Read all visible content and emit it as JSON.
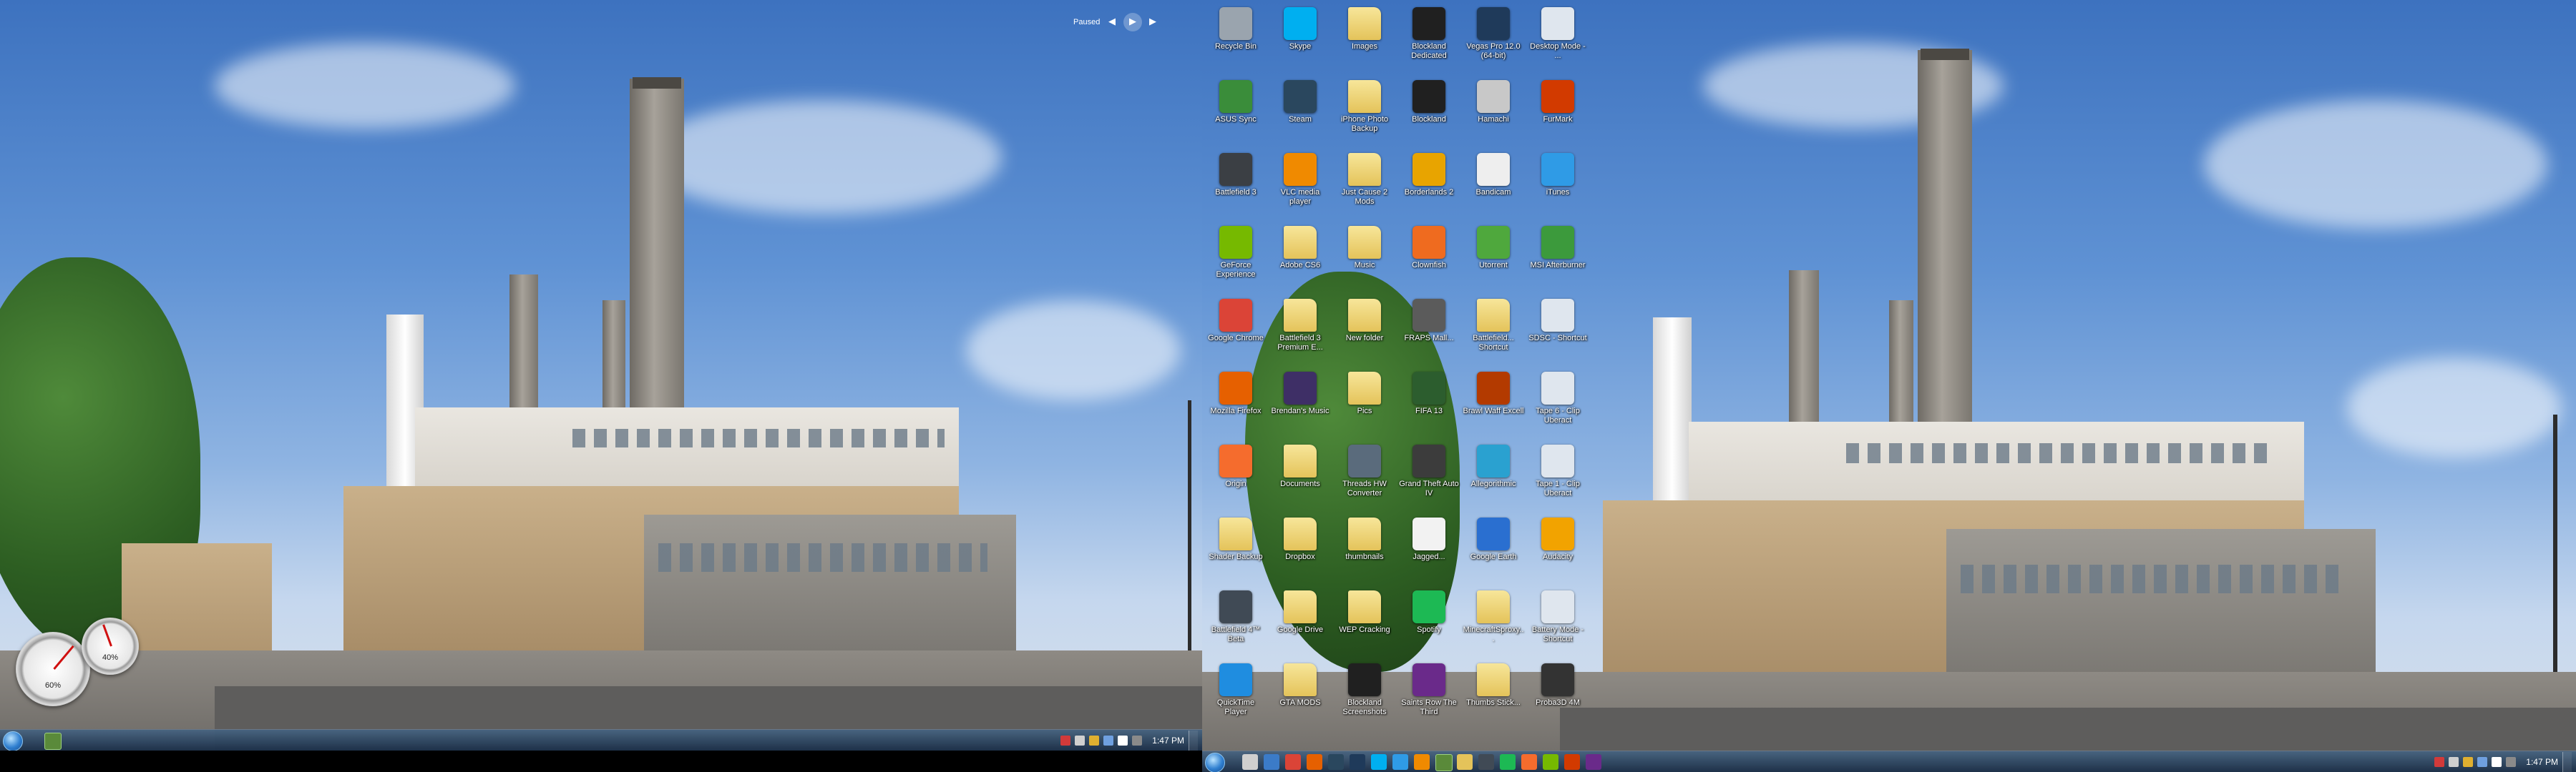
{
  "left_monitor": {
    "taskbar": {
      "clock": "1:47 PM"
    },
    "media_gadget": {
      "label": "Paused"
    },
    "gadgets": [
      {
        "name": "cpu-meter",
        "value": "60%"
      },
      {
        "name": "memory-meter",
        "value": "40%"
      }
    ]
  },
  "right_monitor": {
    "taskbar": {
      "clock": "1:47 PM"
    },
    "desktop_icons": [
      {
        "label": "Recycle Bin",
        "icon": "recycle-bin-icon",
        "color": "#9aa4ae"
      },
      {
        "label": "ASUS Sync",
        "icon": "asus-sync-icon",
        "color": "#3a8d3a"
      },
      {
        "label": "Battlefield 3",
        "icon": "battlefield-icon",
        "color": "#3b3f44"
      },
      {
        "label": "GeForce Experience",
        "icon": "geforce-icon",
        "color": "#76b900"
      },
      {
        "label": "Google Chrome",
        "icon": "chrome-icon",
        "color": "#db4437"
      },
      {
        "label": "Mozilla Firefox",
        "icon": "firefox-icon",
        "color": "#e66000"
      },
      {
        "label": "Origin",
        "icon": "origin-icon",
        "color": "#f56c2d"
      },
      {
        "label": "Shader Backup",
        "icon": "folder-icon",
        "color": "#e4c35a"
      },
      {
        "label": "Battlefield 4™ Beta",
        "icon": "battlefield4-icon",
        "color": "#404a55"
      },
      {
        "label": "QuickTime Player",
        "icon": "quicktime-icon",
        "color": "#1f8de0"
      },
      {
        "label": "Skype",
        "icon": "skype-icon",
        "color": "#00aff0"
      },
      {
        "label": "Steam",
        "icon": "steam-icon",
        "color": "#2a475e"
      },
      {
        "label": "VLC media player",
        "icon": "vlc-icon",
        "color": "#f08a00"
      },
      {
        "label": "Adobe CS6",
        "icon": "folder-icon",
        "color": "#e4c35a"
      },
      {
        "label": "Battlefield 3 Premium E...",
        "icon": "folder-icon",
        "color": "#e4c35a"
      },
      {
        "label": "Brendan's Music",
        "icon": "music-folder-icon",
        "color": "#3e2f66"
      },
      {
        "label": "Documents",
        "icon": "folder-icon",
        "color": "#e4c35a"
      },
      {
        "label": "Dropbox",
        "icon": "folder-icon",
        "color": "#e4c35a"
      },
      {
        "label": "Google Drive",
        "icon": "folder-icon",
        "color": "#e4c35a"
      },
      {
        "label": "GTA MODS",
        "icon": "folder-icon",
        "color": "#e4c35a"
      },
      {
        "label": "Images",
        "icon": "folder-icon",
        "color": "#e4c35a"
      },
      {
        "label": "iPhone Photo Backup",
        "icon": "folder-icon",
        "color": "#e4c35a"
      },
      {
        "label": "Just Cause 2 Mods",
        "icon": "folder-icon",
        "color": "#e4c35a"
      },
      {
        "label": "Music",
        "icon": "folder-icon",
        "color": "#e4c35a"
      },
      {
        "label": "New folder",
        "icon": "folder-icon",
        "color": "#e4c35a"
      },
      {
        "label": "Pics",
        "icon": "folder-icon",
        "color": "#e4c35a"
      },
      {
        "label": "Threads HW Converter",
        "icon": "threads-icon",
        "color": "#5a6b7c"
      },
      {
        "label": "thumbnails",
        "icon": "folder-icon",
        "color": "#e4c35a"
      },
      {
        "label": "WEP Cracking",
        "icon": "folder-icon",
        "color": "#e4c35a"
      },
      {
        "label": "Blockland Screenshots",
        "icon": "blockland-icon",
        "color": "#202020"
      },
      {
        "label": "Blockland Dedicated",
        "icon": "blockland-icon",
        "color": "#202020"
      },
      {
        "label": "Blockland",
        "icon": "blockland-icon",
        "color": "#202020"
      },
      {
        "label": "Borderlands 2",
        "icon": "borderlands-icon",
        "color": "#e8a400"
      },
      {
        "label": "Clownfish",
        "icon": "clownfish-icon",
        "color": "#ef6b1f"
      },
      {
        "label": "FRAPS Mall...",
        "icon": "fraps-icon",
        "color": "#5b5b5b"
      },
      {
        "label": "FIFA 13",
        "icon": "fifa-icon",
        "color": "#2c5d2e"
      },
      {
        "label": "Grand Theft Auto IV",
        "icon": "gta-icon",
        "color": "#3c3c3c"
      },
      {
        "label": "Jagged...",
        "icon": "document-icon",
        "color": "#f2f2f2"
      },
      {
        "label": "Spotify",
        "icon": "spotify-icon",
        "color": "#1db954"
      },
      {
        "label": "Saints Row The Third",
        "icon": "saints-row-icon",
        "color": "#6a2a8a"
      },
      {
        "label": "Vegas Pro 12.0 (64-bit)",
        "icon": "vegas-icon",
        "color": "#1f3a5a"
      },
      {
        "label": "Hamachi",
        "icon": "hamachi-icon",
        "color": "#c8c8c8"
      },
      {
        "label": "Bandicam",
        "icon": "bandicam-icon",
        "color": "#eeeeee"
      },
      {
        "label": "Utorrent",
        "icon": "utorrent-icon",
        "color": "#4fa83d"
      },
      {
        "label": "Battlefield... Shortcut",
        "icon": "folder-shortcut-icon",
        "color": "#e4c35a"
      },
      {
        "label": "Brawl Waff Excell",
        "icon": "excel-icon",
        "color": "#b33a00"
      },
      {
        "label": "Allegorithmic",
        "icon": "allegorithmic-icon",
        "color": "#2aa1d0"
      },
      {
        "label": "Google Earth",
        "icon": "google-earth-icon",
        "color": "#2a6fd0"
      },
      {
        "label": "MinecraftSproxy...",
        "icon": "folder-icon",
        "color": "#e4c35a"
      },
      {
        "label": "Thumbs Stick...",
        "icon": "folder-icon",
        "color": "#e4c35a"
      },
      {
        "label": "Desktop Mode - ...",
        "icon": "desktop-mode-icon",
        "color": "#dfe6ee"
      },
      {
        "label": "FurMark",
        "icon": "furmark-icon",
        "color": "#d23a00"
      },
      {
        "label": "iTunes",
        "icon": "itunes-icon",
        "color": "#2f9be6"
      },
      {
        "label": "MSI Afterburner",
        "icon": "afterburner-icon",
        "color": "#3c9a3c"
      },
      {
        "label": "SDSC - Shortcut",
        "icon": "shortcut-icon",
        "color": "#dfe6ee"
      },
      {
        "label": "Tape 6 - Clip Uberact",
        "icon": "clip-icon",
        "color": "#dfe6ee"
      },
      {
        "label": "Tape 1 - Clip Uberact",
        "icon": "clip-icon",
        "color": "#dfe6ee"
      },
      {
        "label": "Audacity",
        "icon": "audacity-icon",
        "color": "#f2a300"
      },
      {
        "label": "Battery Mode - Shortcut",
        "icon": "battery-mode-icon",
        "color": "#dfe6ee"
      },
      {
        "label": "Proba3D 4M",
        "icon": "proba-icon",
        "color": "#333333"
      }
    ]
  }
}
